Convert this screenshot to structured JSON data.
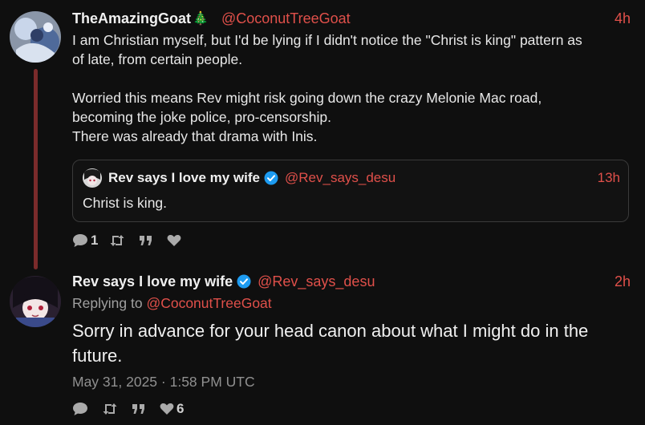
{
  "tweet1": {
    "display_name": "TheAmazingGoat",
    "emoji": "🎄",
    "handle": "@CoconutTreeGoat",
    "time": "4h",
    "body": "I am Christian myself, but I'd be lying if I didn't notice the \"Christ is king\" pattern as\nof late, from certain people.\n\nWorried this means Rev might risk going down the crazy Melonie Mac road,\nbecoming the joke police, pro-censorship.\nThere was already that drama with Inis.",
    "quote": {
      "display_name": "Rev says I love my wife",
      "handle": "@Rev_says_desu",
      "time": "13h",
      "text": "Christ is king."
    },
    "actions": {
      "reply_count": "1",
      "retweet_count": "",
      "quote_count": "",
      "like_count": ""
    }
  },
  "tweet2": {
    "display_name": "Rev says I love my wife",
    "handle": "@Rev_says_desu",
    "time": "2h",
    "replying_prefix": "Replying to",
    "replying_handle": "@CoconutTreeGoat",
    "body": "Sorry in advance for your head canon about what I might do in the future.",
    "date": "May 31, 2025 · 1:58 PM UTC",
    "actions": {
      "reply_count": "",
      "retweet_count": "",
      "quote_count": "",
      "like_count": "6"
    }
  },
  "colors": {
    "background": "#0f0f0f",
    "accent": "#e0504a",
    "thread_line": "#7a2b2b",
    "verified": "#1d9bf0"
  },
  "icons": [
    "reply-icon",
    "retweet-icon",
    "quote-icon",
    "like-icon",
    "verified-badge-icon",
    "christmas-tree-emoji"
  ]
}
